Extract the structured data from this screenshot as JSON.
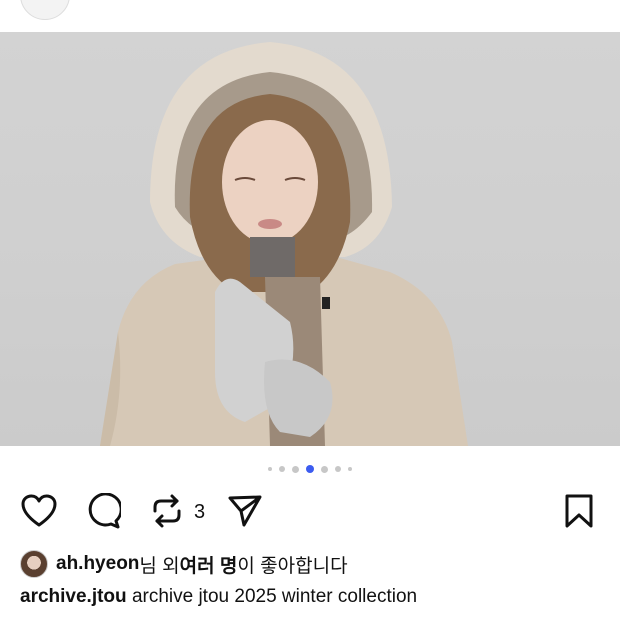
{
  "post": {
    "image": {
      "description_icon": "photo-model-hood-gloves",
      "carousel": {
        "total_dots": 7,
        "active_index": 3
      }
    },
    "actions": {
      "like_icon": "heart-icon",
      "comment_icon": "comment-icon",
      "repost_icon": "repost-icon",
      "repost_count": "3",
      "share_icon": "send-icon",
      "save_icon": "bookmark-icon"
    },
    "likes": {
      "username": "ah.hyeon",
      "text_after_user": "님 외 ",
      "others_bold": "여러 명",
      "text_end": "이 좋아합니다"
    },
    "caption": {
      "username": "archive.jtou",
      "text": "archive jtou 2025 winter collection"
    }
  },
  "colors": {
    "accent": "#3c5cf0",
    "dot_inactive": "#c7c7c7",
    "text": "#111111"
  }
}
